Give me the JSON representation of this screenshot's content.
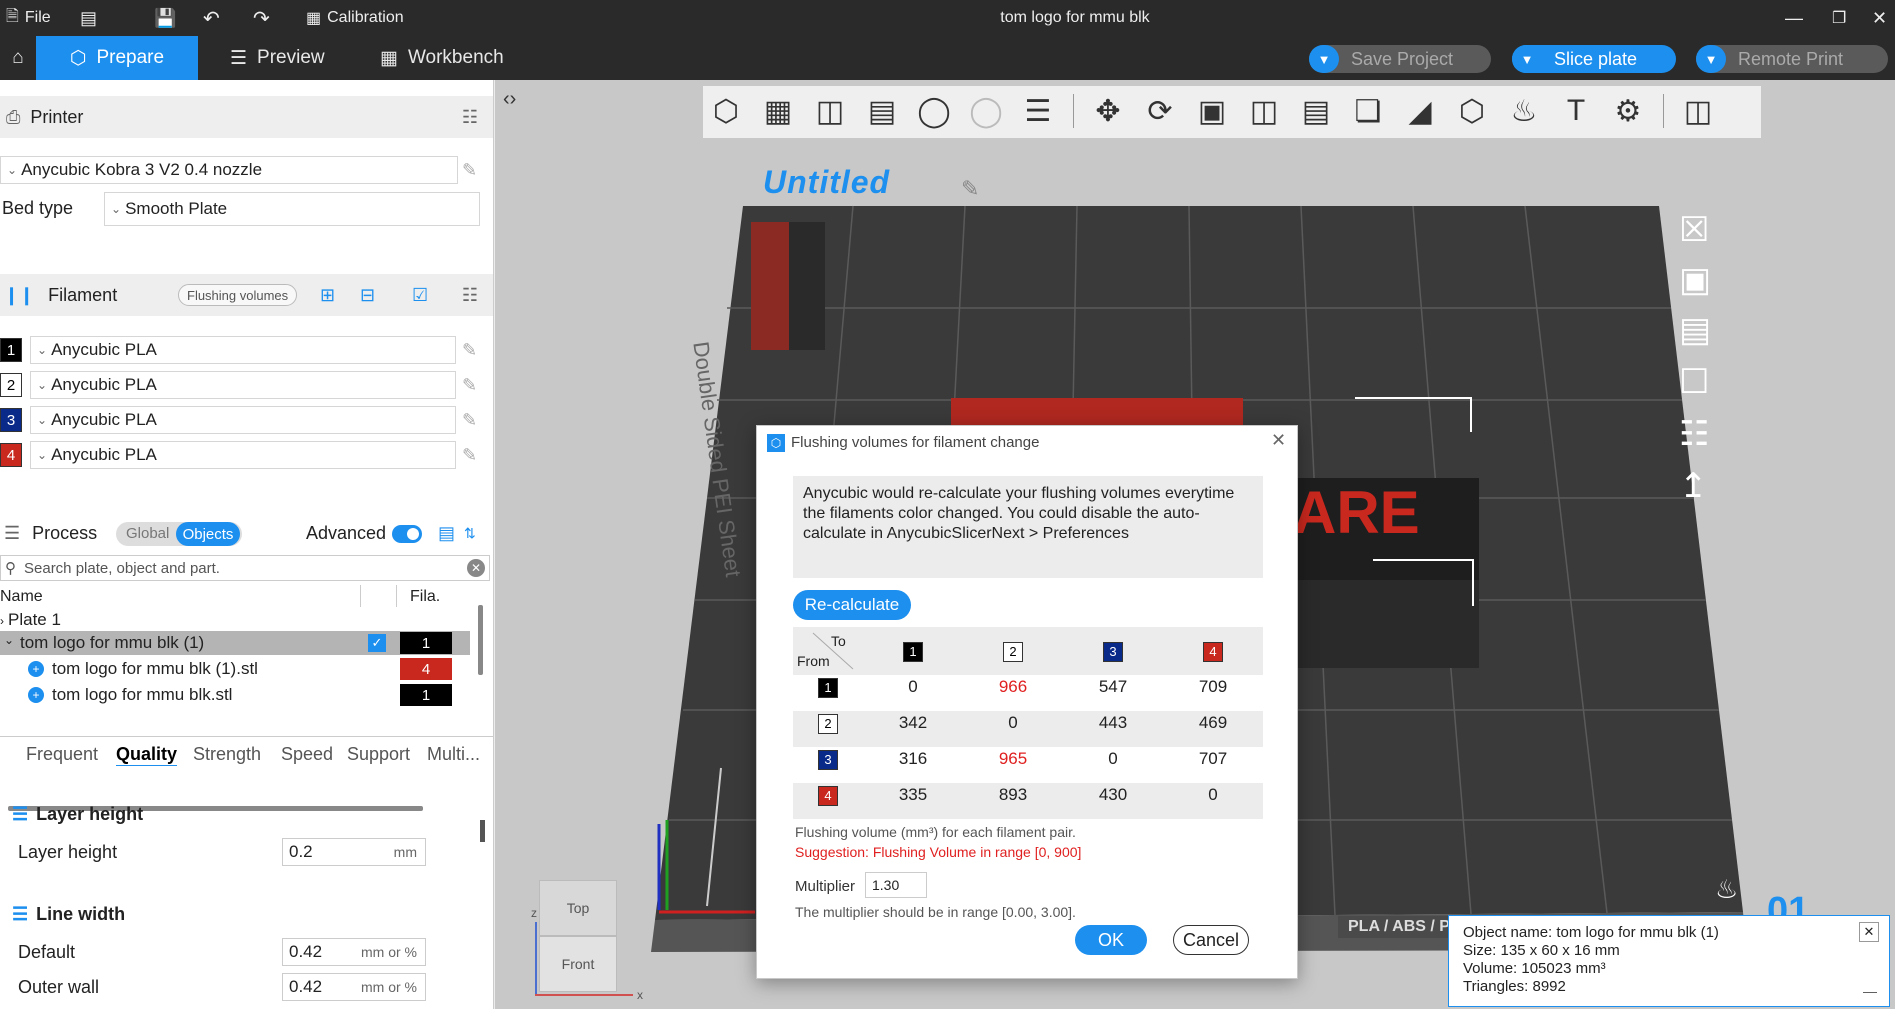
{
  "titlebar": {
    "file": "File",
    "calibration": "Calibration",
    "title": "tom logo for mmu blk"
  },
  "tabs": {
    "prepare": "Prepare",
    "preview": "Preview",
    "workbench": "Workbench"
  },
  "actions": {
    "save_project": "Save Project",
    "slice_plate": "Slice plate",
    "remote_print": "Remote Print"
  },
  "printer": {
    "heading": "Printer",
    "name": "Anycubic Kobra 3 V2 0.4 nozzle",
    "bed_label": "Bed type",
    "bed_value": "Smooth Plate"
  },
  "filament": {
    "heading": "Filament",
    "flush_button": "Flushing volumes",
    "items": [
      {
        "num": "1",
        "name": "Anycubic PLA",
        "color": "#000000"
      },
      {
        "num": "2",
        "name": "Anycubic PLA",
        "color": "#ffffff"
      },
      {
        "num": "3",
        "name": "Anycubic PLA",
        "color": "#0a2a8a"
      },
      {
        "num": "4",
        "name": "Anycubic PLA",
        "color": "#c8281e"
      }
    ]
  },
  "process": {
    "heading": "Process",
    "global": "Global",
    "objects": "Objects",
    "advanced": "Advanced"
  },
  "search": {
    "placeholder": "Search plate, object and part."
  },
  "objects": {
    "col_name": "Name",
    "col_fila": "Fila.",
    "plate": "Plate 1",
    "rows": [
      {
        "name": "tom logo for mmu blk (1)",
        "fila": "1"
      },
      {
        "name": "tom logo for mmu blk (1).stl",
        "fila": "4"
      },
      {
        "name": "tom logo for mmu blk.stl",
        "fila": "1"
      }
    ]
  },
  "settings_tabs": [
    "Frequent",
    "Quality",
    "Strength",
    "Speed",
    "Support",
    "Multi..."
  ],
  "layer": {
    "heading": "Layer height",
    "label": "Layer height",
    "value": "0.2",
    "unit": "mm"
  },
  "linewidth": {
    "heading": "Line width",
    "default_label": "Default",
    "default_value": "0.42",
    "outer_label": "Outer wall",
    "outer_value": "0.42",
    "unit": "mm or %"
  },
  "viewport": {
    "plate_name": "Untitled",
    "bed_text": "Double Sided PEI Sheet",
    "text_visible": "ARE",
    "cube_top": "Top",
    "cube_front": "Front",
    "axis_z": "z",
    "axis_x": "x",
    "plate_badge": "PLA / ABS / P",
    "plate_number": "01"
  },
  "dialog": {
    "title": "Flushing volumes for filament change",
    "info": "Anycubic would re-calculate your flushing volumes everytime the filaments color changed. You could disable the auto-calculate in AnycubicSlicerNext > Preferences",
    "recalc": "Re-calculate",
    "to": "To",
    "from": "From",
    "matrix": [
      [
        "0",
        "966",
        "547",
        "709"
      ],
      [
        "342",
        "0",
        "443",
        "469"
      ],
      [
        "316",
        "965",
        "0",
        "707"
      ],
      [
        "335",
        "893",
        "430",
        "0"
      ]
    ],
    "note": "Flushing volume (mm³) for each filament pair.",
    "suggestion": "Suggestion: Flushing Volume in range [0, 900]",
    "multiplier_label": "Multiplier",
    "multiplier_value": "1.30",
    "range_note": "The multiplier should be in range [0.00, 3.00].",
    "ok": "OK",
    "cancel": "Cancel"
  },
  "info": {
    "name": "Object name: tom logo for mmu blk (1)",
    "size": "Size: 135 x 60 x 16 mm",
    "volume": "Volume: 105023 mm³",
    "triangles": "Triangles: 8992"
  },
  "colors": {
    "accent": "#1c8fef",
    "warning": "#e02020"
  }
}
